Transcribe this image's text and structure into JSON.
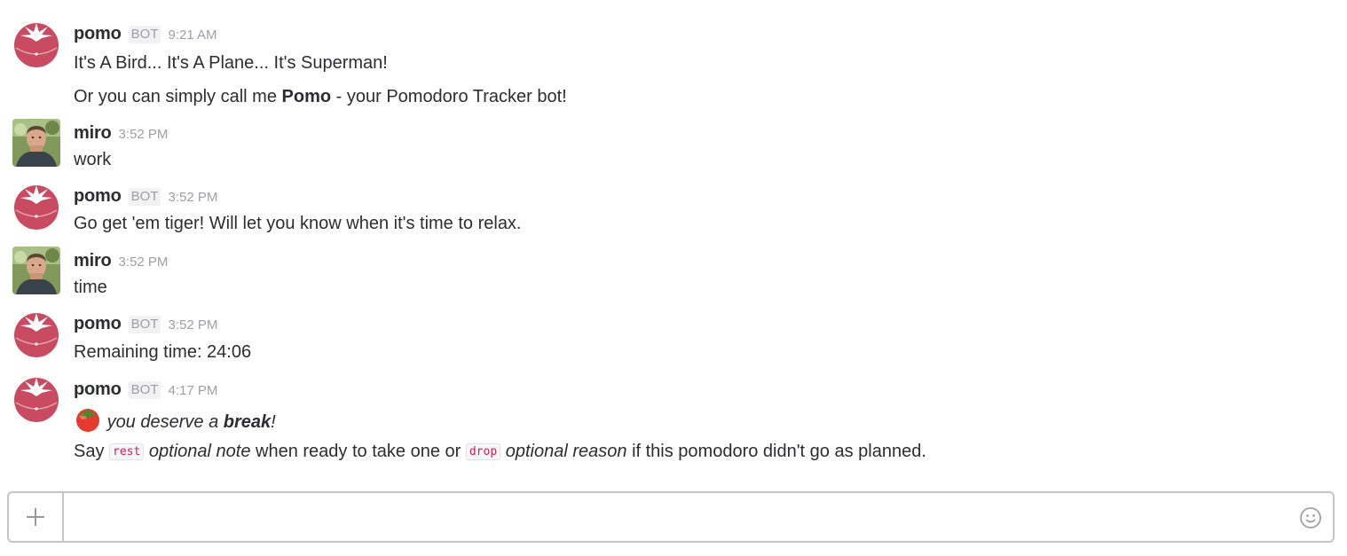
{
  "messages": [
    {
      "author": "pomo",
      "bot_label": "BOT",
      "time": "9:21 AM",
      "line1": "It's A Bird... It's A Plane... It's Superman!",
      "line2_prefix": "Or you can simply call me ",
      "line2_bold": "Pomo",
      "line2_suffix": " - your Pomodoro Tracker bot!"
    },
    {
      "author": "miro",
      "time": "3:52 PM",
      "text": "work"
    },
    {
      "author": "pomo",
      "bot_label": "BOT",
      "time": "3:52 PM",
      "text": "Go get 'em tiger! Will let you know when it's time to relax."
    },
    {
      "author": "miro",
      "time": "3:52 PM",
      "text": "time"
    },
    {
      "author": "pomo",
      "bot_label": "BOT",
      "time": "3:52 PM",
      "text": "Remaining time: 24:06"
    },
    {
      "author": "pomo",
      "bot_label": "BOT",
      "time": "4:17 PM",
      "emoji": "tomato-emoji",
      "break_prefix": "you deserve a ",
      "break_bold": "break",
      "break_suffix": "!",
      "say": "Say",
      "rest_code": "rest",
      "rest_note": "optional note",
      "middle": "when ready to take one or",
      "drop_code": "drop",
      "drop_reason": "optional reason",
      "end": "if this pomodoro didn't go as planned."
    }
  ],
  "composer": {
    "placeholder": "",
    "plus_icon": "plus-icon",
    "emoji_icon": "smiley-icon"
  },
  "colors": {
    "tomato": "#c84b62",
    "code_text": "#cc2255",
    "muted": "#9e9ea6"
  }
}
